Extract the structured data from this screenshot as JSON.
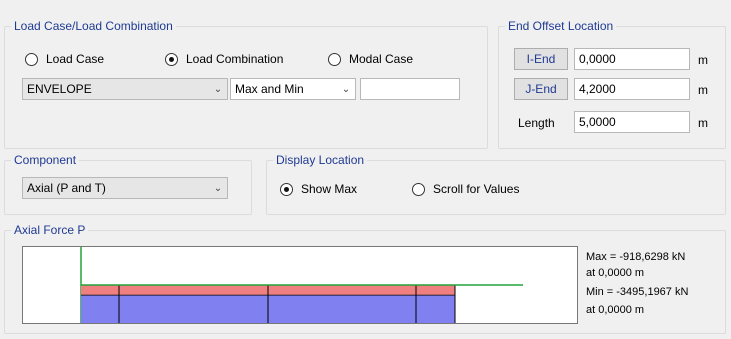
{
  "load_case_group": {
    "title": "Load Case/Load Combination",
    "radios": [
      {
        "label": "Load Case",
        "selected": false
      },
      {
        "label": "Load Combination",
        "selected": true
      },
      {
        "label": "Modal Case",
        "selected": false
      }
    ],
    "case_select": "ENVELOPE",
    "mode_select": "Max and Min",
    "extra_value": ""
  },
  "end_offset_group": {
    "title": "End Offset Location",
    "rows": [
      {
        "label": "I-End",
        "value": "0,0000",
        "unit": "m"
      },
      {
        "label": "J-End",
        "value": "4,2000",
        "unit": "m"
      },
      {
        "label": "Length",
        "value": "5,0000",
        "unit": "m"
      }
    ]
  },
  "component_group": {
    "title": "Component",
    "select": "Axial (P and T)"
  },
  "display_location_group": {
    "title": "Display Location",
    "radios": [
      {
        "label": "Show Max",
        "selected": true
      },
      {
        "label": "Scroll for Values",
        "selected": false
      }
    ]
  },
  "axial_group": {
    "title": "Axial Force P",
    "max_text": "Max = -918,6298 kN",
    "max_at": "at 0,0000 m",
    "min_text": "Min = -3495,1967 kN",
    "min_at": "at 0,0000 m"
  },
  "diagram": {
    "max_color": "#f08080",
    "min_color": "#8080f0",
    "member_line_color": "#22a33a",
    "max_value": -918.6298,
    "min_value": -3495.1967,
    "length": 5.0,
    "i_end": 0.0,
    "j_end": 4.2
  }
}
